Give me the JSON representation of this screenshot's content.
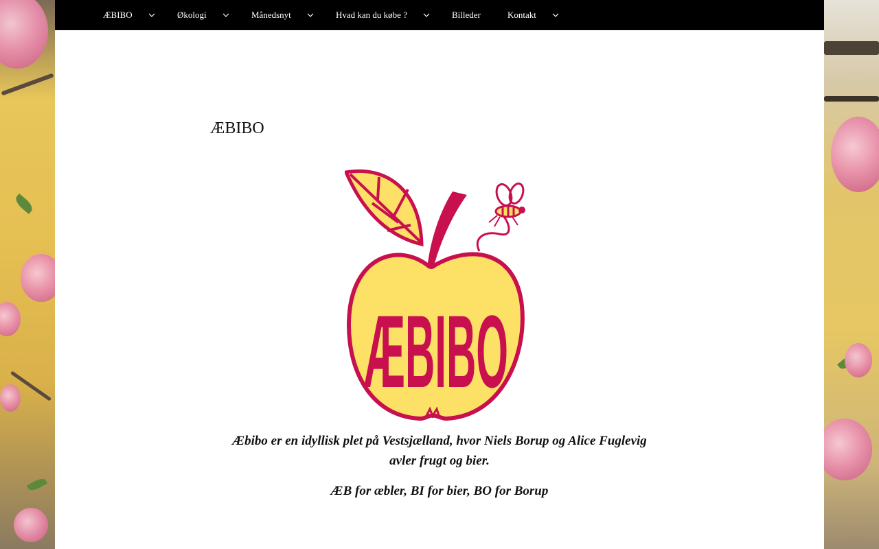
{
  "nav": {
    "items": [
      {
        "label": "ÆBIBO",
        "has_submenu": true
      },
      {
        "label": "Økologi",
        "has_submenu": true
      },
      {
        "label": "Månedsnyt",
        "has_submenu": true
      },
      {
        "label": "Hvad kan du købe ?",
        "has_submenu": true
      },
      {
        "label": "Billeder",
        "has_submenu": false
      },
      {
        "label": "Kontakt",
        "has_submenu": true
      }
    ]
  },
  "header": {
    "site_title": "ÆBIBO"
  },
  "logo": {
    "text": "ÆBIBO",
    "icon": "apple-bee-logo"
  },
  "content": {
    "intro": "Æbibo er en idyllisk plet på Vestsjælland, hvor Niels Borup og Alice Fuglevig avler frugt og bier.",
    "tagline": "ÆB for æbler, BI for bier, BO for Borup"
  },
  "colors": {
    "nav_bg": "#000000",
    "logo_red": "#c8104f",
    "logo_yellow": "#fde066",
    "page_bg": "#ffffff"
  }
}
